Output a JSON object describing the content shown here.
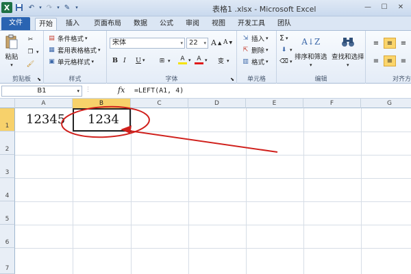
{
  "window": {
    "title": "表格1 .xlsx - Microsoft Excel",
    "app_icon": "X"
  },
  "ribbon_tabs": [
    {
      "label": "文件",
      "active": false
    },
    {
      "label": "开始",
      "active": true
    },
    {
      "label": "插入",
      "active": false
    },
    {
      "label": "页面布局",
      "active": false
    },
    {
      "label": "数据",
      "active": false
    },
    {
      "label": "公式",
      "active": false
    },
    {
      "label": "审阅",
      "active": false
    },
    {
      "label": "视图",
      "active": false
    },
    {
      "label": "开发工具",
      "active": false
    },
    {
      "label": "团队",
      "active": false
    }
  ],
  "ribbon": {
    "clipboard": {
      "paste": "粘贴",
      "label": "剪贴板"
    },
    "styles": {
      "conditional": "条件格式",
      "table_format": "套用表格格式",
      "cell_styles": "单元格样式",
      "label": "样式"
    },
    "font": {
      "name": "宋体",
      "size": "22",
      "grow": "A",
      "shrink": "A",
      "bold": "B",
      "italic": "I",
      "underline": "U",
      "fill_glyph": "A",
      "color_glyph": "A",
      "phonetic_glyph": "变",
      "label": "字体"
    },
    "cells": {
      "insert": "插入",
      "delete": "删除",
      "format": "格式",
      "label": "单元格"
    },
    "editing": {
      "sum_glyph": "Σ",
      "sort_filter": "排序和筛选",
      "find_select": "查找和选择",
      "label": "编辑"
    },
    "alignment": {
      "label": "对齐方"
    }
  },
  "formula_bar": {
    "name_box": "B1",
    "fx": "fx",
    "formula": "=LEFT(A1, 4)"
  },
  "columns": [
    "A",
    "B",
    "C",
    "D",
    "E",
    "F",
    "G"
  ],
  "rows": [
    "1",
    "2",
    "3",
    "4",
    "5",
    "6",
    "7"
  ],
  "cells": {
    "A1": "12345",
    "B1": "1234"
  },
  "colors": {
    "file_tab": "#2a64b2",
    "selection_header": "#f7d16b",
    "annotation": "#d0201c"
  }
}
